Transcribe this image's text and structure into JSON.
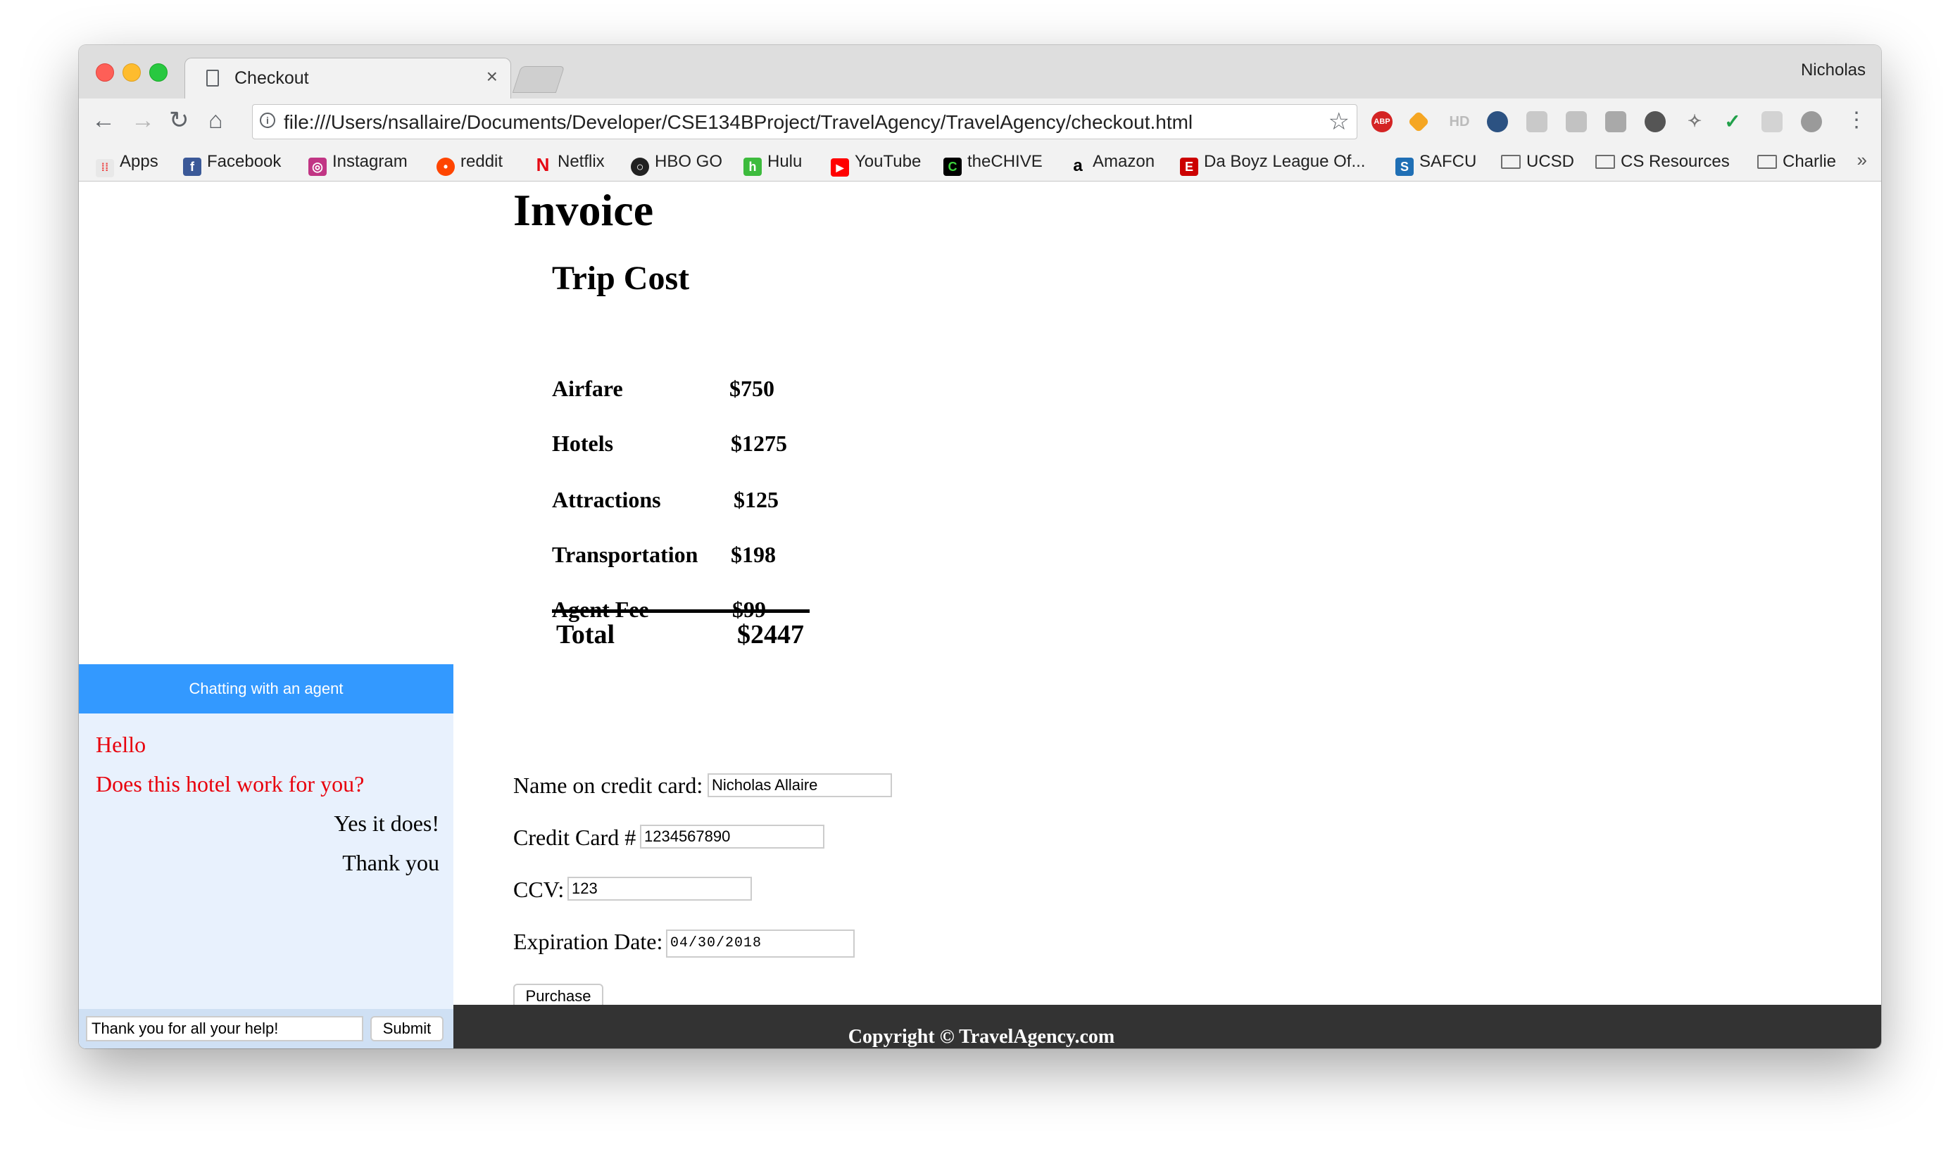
{
  "browser": {
    "tab_title": "Checkout",
    "profile_name": "Nicholas",
    "url": "file:///Users/nsallaire/Documents/Developer/CSE134BProject/TravelAgency/TravelAgency/checkout.html",
    "extensions": [
      "ABP",
      "HD"
    ],
    "bookmarks": [
      {
        "label": "Apps",
        "icon": "apps-grid-icon"
      },
      {
        "label": "Facebook",
        "icon": "facebook-icon"
      },
      {
        "label": "Instagram",
        "icon": "instagram-icon"
      },
      {
        "label": "reddit",
        "icon": "reddit-icon"
      },
      {
        "label": "Netflix",
        "icon": "netflix-icon"
      },
      {
        "label": "HBO GO",
        "icon": "hbo-icon"
      },
      {
        "label": "Hulu",
        "icon": "hulu-icon"
      },
      {
        "label": "YouTube",
        "icon": "youtube-icon"
      },
      {
        "label": "theCHIVE",
        "icon": "chive-icon"
      },
      {
        "label": "Amazon",
        "icon": "amazon-icon"
      },
      {
        "label": "Da Boyz League Of...",
        "icon": "espn-icon"
      },
      {
        "label": "SAFCU",
        "icon": "safcu-icon"
      },
      {
        "label": "UCSD",
        "icon": "folder-icon"
      },
      {
        "label": "CS Resources",
        "icon": "folder-icon"
      },
      {
        "label": "Charlie",
        "icon": "folder-icon"
      }
    ],
    "bookmarks_overflow": "»"
  },
  "invoice": {
    "title": "Invoice",
    "section_title": "Trip Cost",
    "items": [
      {
        "label": "Airfare",
        "value": "$750"
      },
      {
        "label": "Hotels",
        "value": "$1275"
      },
      {
        "label": "Attractions",
        "value": "$125"
      },
      {
        "label": "Transportation",
        "value": "$198"
      },
      {
        "label": "Agent Fee",
        "value": "$99"
      }
    ],
    "total_label": "Total",
    "total_value": "$2447"
  },
  "form": {
    "name_label": "Name on credit card:",
    "name_value": "Nicholas Allaire",
    "card_label": "Credit Card #",
    "card_value": "1234567890",
    "ccv_label": "CCV:",
    "ccv_value": "123",
    "exp_label": "Expiration Date:",
    "exp_value": "04/30/2018",
    "purchase_label": "Purchase"
  },
  "chat": {
    "header": "Chatting with an agent",
    "messages": [
      {
        "from": "agent",
        "text": "Hello"
      },
      {
        "from": "agent",
        "text": "Does this hotel work for you?"
      },
      {
        "from": "user",
        "text": "Yes it does!"
      },
      {
        "from": "user",
        "text": "Thank you"
      }
    ],
    "input_value": "Thank you for all your help!",
    "submit_label": "Submit"
  },
  "footer": {
    "text": "Copyright © TravelAgency.com"
  },
  "colors": {
    "chat_header": "#3399ff",
    "chat_background": "#e8f1fd",
    "agent_message": "#e8000c",
    "footer_background": "#333333"
  }
}
